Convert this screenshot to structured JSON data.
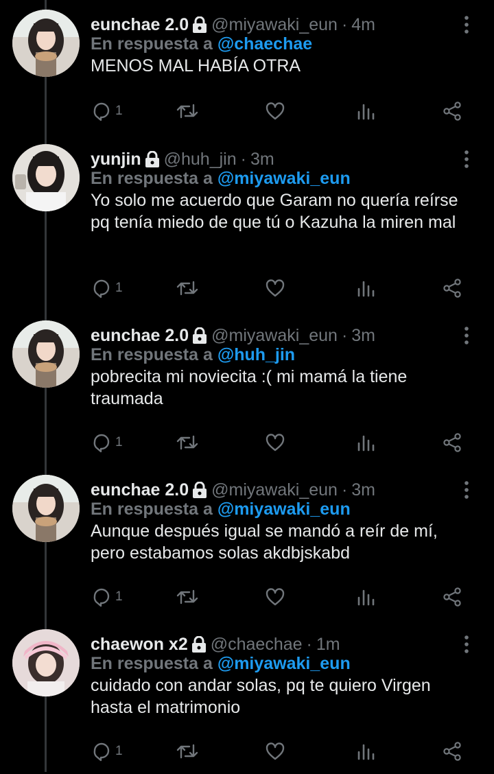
{
  "ui": {
    "reply_prefix": "En respuesta a"
  },
  "tweets": [
    {
      "name": "eunchae 2.0",
      "handle": "@miyawaki_eun",
      "time": "4m",
      "reply_to": "@chaechae",
      "text": "MENOS MAL HABÍA OTRA",
      "reply_count": "1",
      "avatar": "girl-dark-hair"
    },
    {
      "name": "yunjin",
      "handle": "@huh_jin",
      "time": "3m",
      "reply_to": "@miyawaki_eun",
      "text": "Yo solo me acuerdo que Garam no quería reírse pq tenía miedo de que tú o Kazuha la miren mal",
      "reply_count": "1",
      "avatar": "girl-white-top"
    },
    {
      "name": "eunchae 2.0",
      "handle": "@miyawaki_eun",
      "time": "3m",
      "reply_to": "@huh_jin",
      "text": "pobrecita mi noviecita :( mi mamá la tiene traumada",
      "reply_count": "1",
      "avatar": "girl-dark-hair"
    },
    {
      "name": "eunchae 2.0",
      "handle": "@miyawaki_eun",
      "time": "3m",
      "reply_to": "@miyawaki_eun",
      "text": "Aunque después igual se mandó a reír de mí, pero estabamos solas akdbjskabd",
      "reply_count": "1",
      "avatar": "girl-dark-hair"
    },
    {
      "name": "chaewon x2",
      "handle": "@chaechae",
      "time": "1m",
      "reply_to": "@miyawaki_eun",
      "text": "cuidado con andar solas, pq te quiero Virgen hasta el matrimonio",
      "reply_count": "1",
      "avatar": "girl-pink-hat"
    }
  ],
  "colors": {
    "background": "#000000",
    "text": "#e7e9ea",
    "muted": "#71767b",
    "accent": "#1d9bf0",
    "thread": "#333639"
  },
  "icons": [
    "lock-icon",
    "more-icon",
    "reply-icon",
    "retweet-icon",
    "like-icon",
    "views-icon",
    "share-icon"
  ]
}
